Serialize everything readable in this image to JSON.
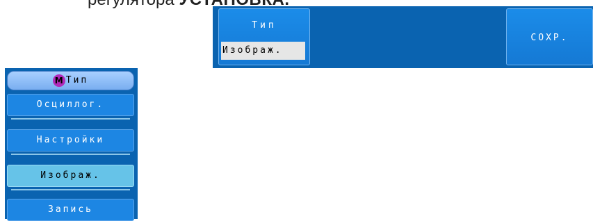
{
  "doc": {
    "caption_prefix": "регулятора ",
    "caption_bold": "УСТАНОВКА."
  },
  "softbar": {
    "type_key": {
      "title": "Тип",
      "value": "Изображ."
    },
    "save_key": {
      "label": "СОХР."
    }
  },
  "side_menu": {
    "header": {
      "badge": "M",
      "label": "Тип"
    },
    "items": [
      {
        "label": "Осциллог."
      },
      {
        "label": "Настройки"
      },
      {
        "label": "Изображ.",
        "selected": true
      },
      {
        "label": "Запись"
      }
    ]
  },
  "colors": {
    "panel_bg": "#0a63b0",
    "key_bg": "#1579d4",
    "selected_item": "#66c3e8",
    "header_bg": "#79aef0",
    "badge": "#b02ab8"
  }
}
